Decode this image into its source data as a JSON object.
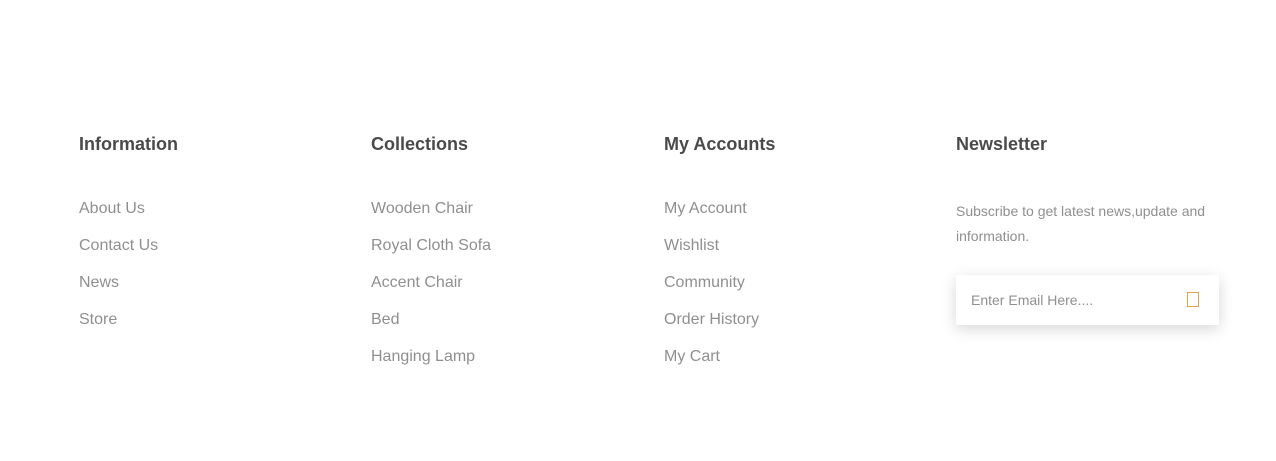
{
  "columns": [
    {
      "title": "Information",
      "links": [
        "About Us",
        "Contact Us",
        "News",
        "Store"
      ]
    },
    {
      "title": "Collections",
      "links": [
        "Wooden Chair",
        "Royal Cloth Sofa",
        "Accent Chair",
        "Bed",
        "Hanging Lamp"
      ]
    },
    {
      "title": "My Accounts",
      "links": [
        "My Account",
        "Wishlist",
        "Community",
        "Order History",
        "My Cart"
      ]
    }
  ],
  "newsletter": {
    "title": "Newsletter",
    "description": "Subscribe to get latest news,update and information.",
    "email_placeholder": "Enter Email Here....",
    "submit_icon": "send-icon"
  },
  "colors": {
    "heading": "#4a4a4a",
    "link": "#8f8f8f",
    "accent": "#e0a24a",
    "background": "#ffffff"
  }
}
